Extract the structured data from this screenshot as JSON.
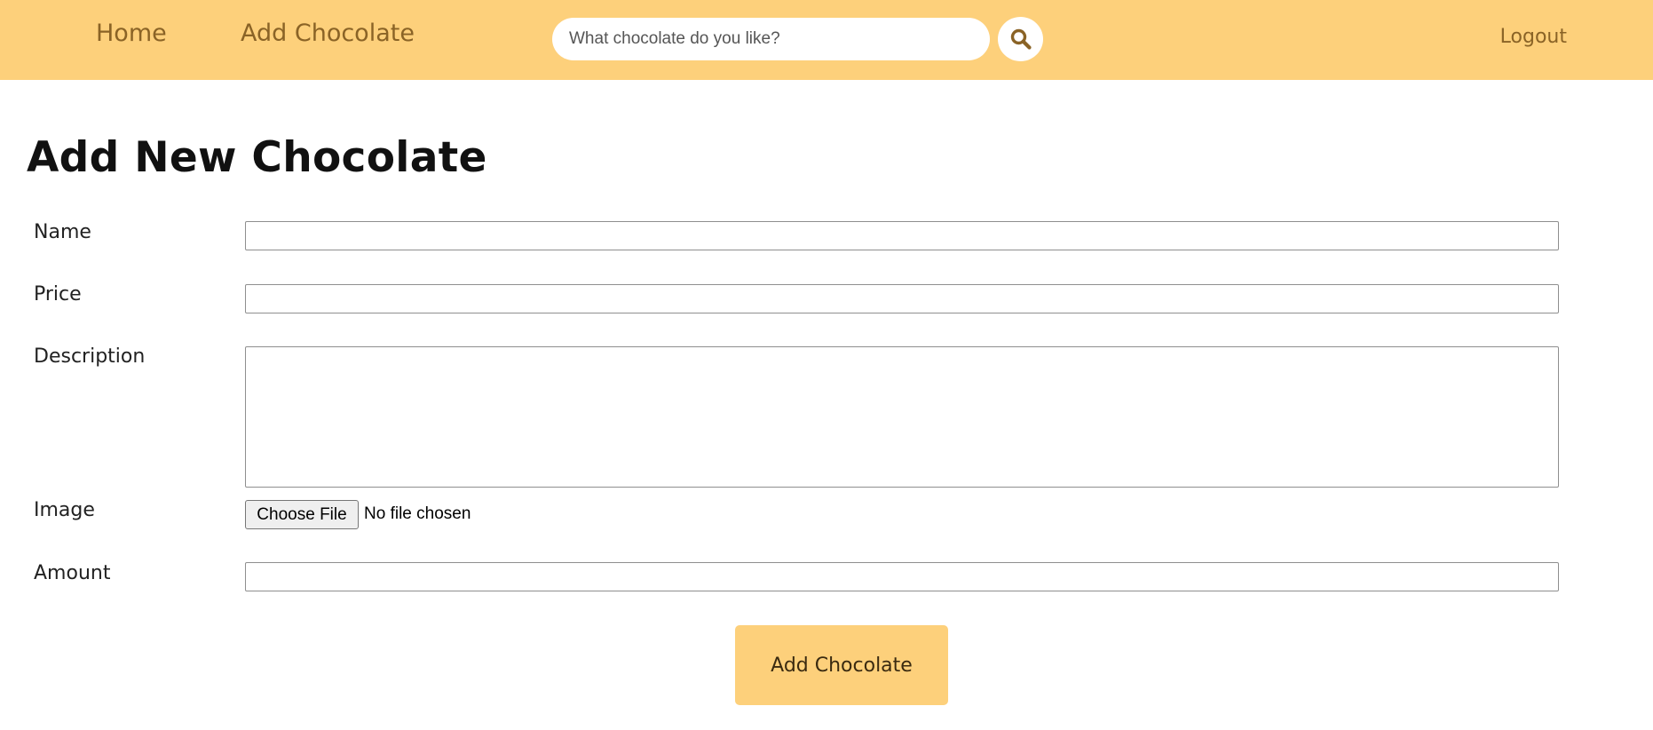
{
  "nav": {
    "home_label": "Home",
    "add_label": "Add Chocolate",
    "logout_label": "Logout",
    "search": {
      "placeholder": "What chocolate do you like?",
      "value": "",
      "icon": "search-icon"
    }
  },
  "page": {
    "title": "Add New Chocolate"
  },
  "form": {
    "name": {
      "label": "Name",
      "value": ""
    },
    "price": {
      "label": "Price",
      "value": ""
    },
    "description": {
      "label": "Description",
      "value": ""
    },
    "image": {
      "label": "Image",
      "button_label": "Choose File",
      "status": "No file chosen"
    },
    "amount": {
      "label": "Amount",
      "value": ""
    },
    "submit_label": "Add Chocolate"
  },
  "colors": {
    "accent": "#fdd07b",
    "nav_text": "#8a6326"
  }
}
